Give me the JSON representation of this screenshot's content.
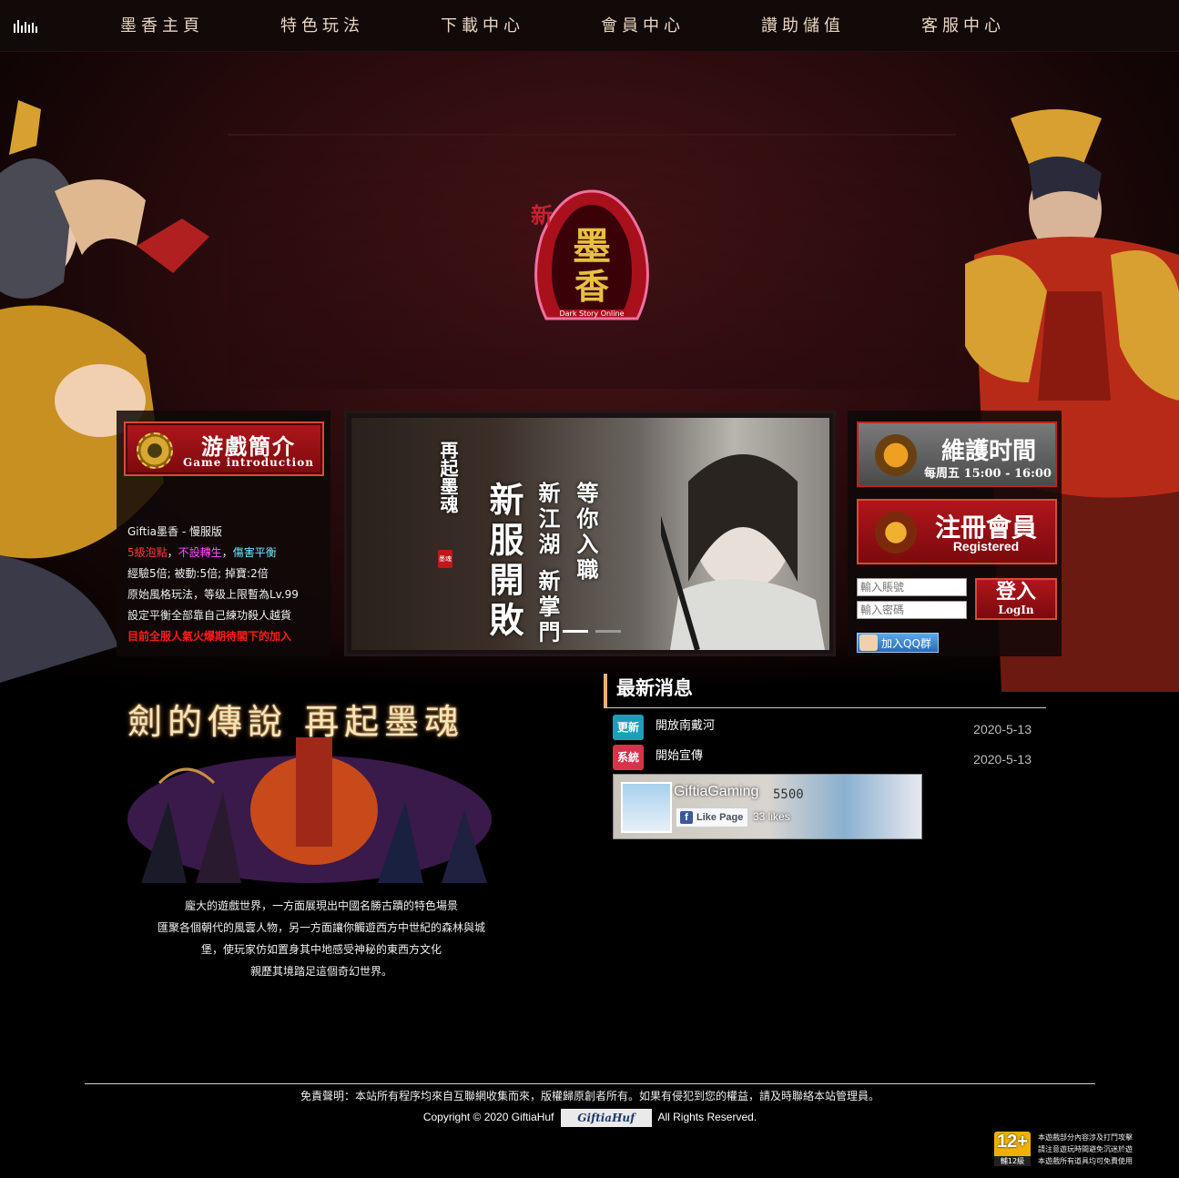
{
  "nav": {
    "items": [
      "墨香主頁",
      "特色玩法",
      "下載中心",
      "會員中心",
      "讚助儲值",
      "客服中心"
    ]
  },
  "logo": {
    "main": "墨香",
    "prefix": "新",
    "sub": "Dark Story Online"
  },
  "intro": {
    "title": "游戲簡介",
    "subtitle": "Game introduction",
    "line1": "Giftia墨香 - 慢服版",
    "line2_a": "5級泡點",
    "line2_b": "不設轉生",
    "line2_c": "傷害平衡",
    "line3": "經驗5倍; 被動:5倍; 掉寶:2倍",
    "line4": "原始風格玩法，等级上限暫為Lv.99",
    "line5": "設定平衡全部靠自己練功殺人越貨",
    "line6": "目前全服人氣火爆期待閣下的加入"
  },
  "slider": {
    "line1": "再起墨魂",
    "line2": "新服開敗",
    "line3": "新江湖 新掌門",
    "line4": "等你入職",
    "stamp": "墨魂"
  },
  "side": {
    "maint_title": "維護时間",
    "maint_time": "每周五 15:00 - 16:00",
    "reg_title": "注冊會員",
    "reg_sub": "Registered",
    "account_placeholder": "輸入賬號",
    "password_placeholder": "輸入密碼",
    "login_label": "登入",
    "login_sub": "LogIn",
    "qq_label": "加入QQ群"
  },
  "legend": {
    "title": "劍的傳說 再起墨魂",
    "desc": [
      "龐大的遊戲世界，一方面展現出中國名勝古蹟的特色場景",
      "匯聚各個朝代的風雲人物，另一方面讓你觸遊西方中世紀的森林與城",
      "堡，使玩家仿如置身其中地感受神秘的東西方文化",
      "親歷其境踏足這個奇幻世界。"
    ]
  },
  "news": {
    "heading": "最新消息",
    "items": [
      {
        "tag": "更新",
        "tag_color": "#1a9fb8",
        "title": "開放南戴河",
        "date": "2020-5-13"
      },
      {
        "tag": "系統",
        "tag_color": "#d8324a",
        "title": "開始宣傳",
        "date": "2020-5-13"
      }
    ]
  },
  "facebook": {
    "name": "GiftiaGaming",
    "like_label": "Like Page",
    "likes": "33 likes",
    "number": "5500"
  },
  "footer": {
    "disclaimer": "免責聲明：本站所有程序均來自互聯網收集而來，版權歸原創者所有。如果有侵犯到您的權益，請及時聯絡本站管理員。",
    "copyright_prefix": "Copyright © 2020 GiftiaHuf",
    "brand": "GiftiaHuf",
    "copyright_suffix": "All Rights Reserved.",
    "rating_num": "12+",
    "rating_label": "輔12級",
    "rating_note": [
      "本遊戲部分內容涉及打鬥攻擊",
      "請注意遊玩時間避免沉迷於遊",
      "本遊戲所有道具均可免費使用"
    ]
  }
}
